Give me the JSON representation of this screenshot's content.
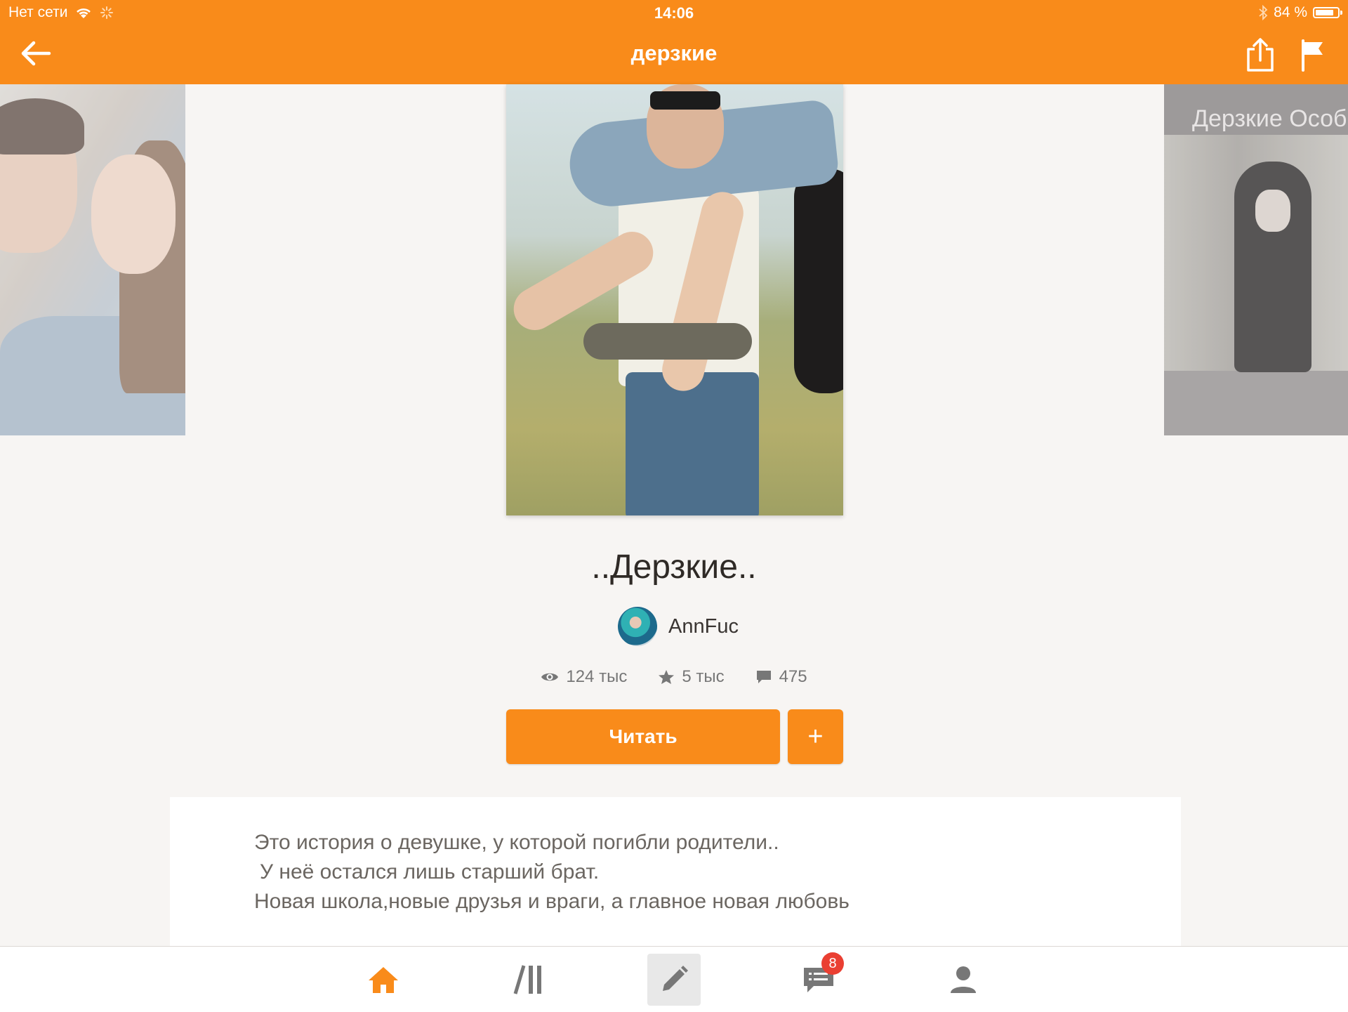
{
  "status_bar": {
    "network": "Нет сети",
    "time": "14:06",
    "battery_text": "84 %",
    "battery_level": 0.84
  },
  "nav": {
    "title": "дерзкие",
    "back_icon": "arrow-left-icon",
    "share_icon": "share-icon",
    "report_icon": "flag-icon"
  },
  "carousel": {
    "right_cover_title": "Дерзкие Особ"
  },
  "story": {
    "title": "..Дерзкие..",
    "author": "AnnFuc",
    "stats": {
      "views": "124 тыс",
      "votes": "5 тыс",
      "comments": "475"
    },
    "read_label": "Читать",
    "add_label": "+",
    "description": [
      "Это история о девушке, у которой погибли родители..",
      "У неё остался лишь старший брат.",
      "Новая школа,новые друзья и враги, а главное новая любовь"
    ]
  },
  "tabbar": {
    "items": [
      {
        "name": "home",
        "icon": "home-icon",
        "active": true
      },
      {
        "name": "library",
        "icon": "library-icon",
        "active": false
      },
      {
        "name": "write",
        "icon": "pencil-icon",
        "active": false
      },
      {
        "name": "messages",
        "icon": "chat-icon",
        "badge": "8",
        "active": false
      },
      {
        "name": "profile",
        "icon": "user-icon",
        "active": false
      }
    ]
  },
  "colors": {
    "accent": "#f98b1a",
    "background": "#f7f5f3",
    "badge": "#ea3f32"
  }
}
